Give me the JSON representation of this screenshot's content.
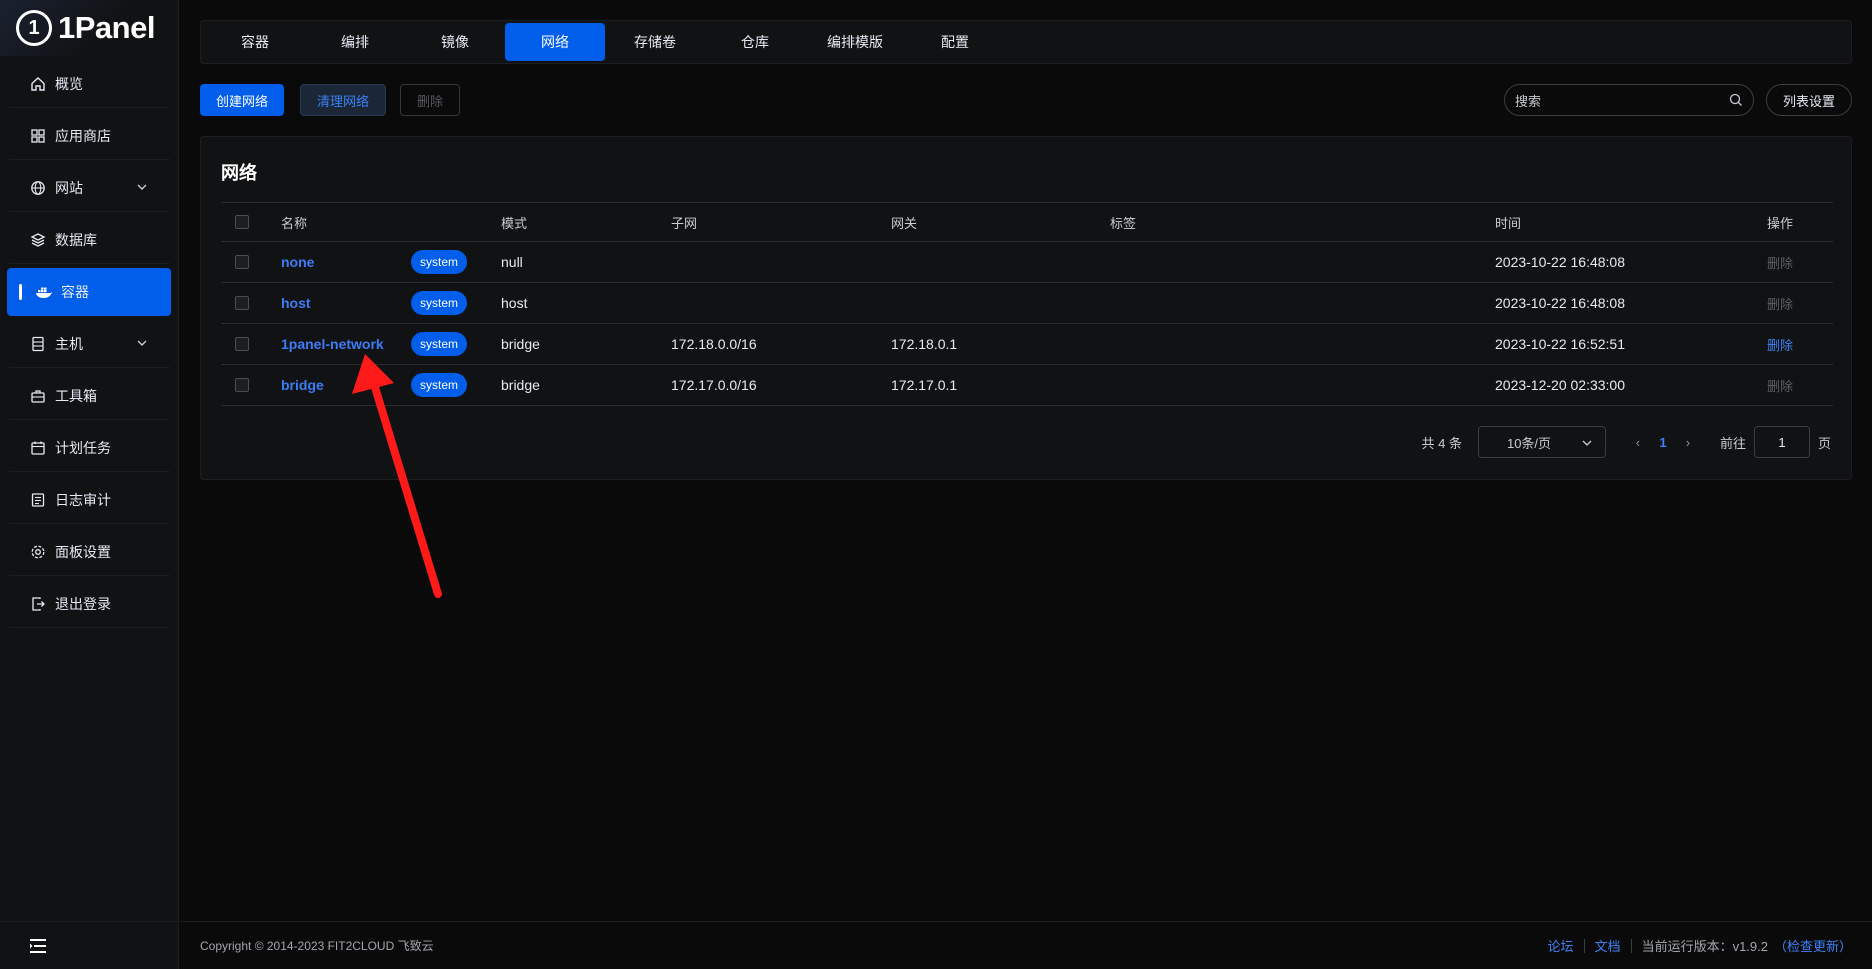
{
  "brand": {
    "logo_glyph": "1",
    "name": "1Panel"
  },
  "sidebar": {
    "items": [
      {
        "label": "概览",
        "icon": "home-icon"
      },
      {
        "label": "应用商店",
        "icon": "grid-icon"
      },
      {
        "label": "网站",
        "icon": "globe-icon",
        "expandable": true
      },
      {
        "label": "数据库",
        "icon": "layers-icon"
      },
      {
        "label": "容器",
        "icon": "docker-icon",
        "active": true
      },
      {
        "label": "主机",
        "icon": "server-icon",
        "expandable": true
      },
      {
        "label": "工具箱",
        "icon": "toolbox-icon"
      },
      {
        "label": "计划任务",
        "icon": "calendar-icon"
      },
      {
        "label": "日志审计",
        "icon": "log-icon"
      },
      {
        "label": "面板设置",
        "icon": "gear-icon"
      },
      {
        "label": "退出登录",
        "icon": "logout-icon"
      }
    ],
    "collapse_icon": "menu-fold-icon"
  },
  "tabs": [
    "容器",
    "编排",
    "镜像",
    "网络",
    "存储卷",
    "仓库",
    "编排模版",
    "配置"
  ],
  "active_tab": "网络",
  "toolbar": {
    "create": "创建网络",
    "prune": "清理网络",
    "delete": "删除",
    "search_placeholder": "搜索",
    "columns": "列表设置"
  },
  "card": {
    "title": "网络"
  },
  "table": {
    "headers": {
      "name": "名称",
      "mode": "模式",
      "subnet": "子网",
      "gateway": "网关",
      "tags": "标签",
      "time": "时间",
      "ops": "操作"
    },
    "rows": [
      {
        "name": "none",
        "tag": "system",
        "mode": "null",
        "subnet": "",
        "gateway": "",
        "time": "2023-10-22 16:48:08",
        "op": "删除",
        "op_enabled": false
      },
      {
        "name": "host",
        "tag": "system",
        "mode": "host",
        "subnet": "",
        "gateway": "",
        "time": "2023-10-22 16:48:08",
        "op": "删除",
        "op_enabled": false
      },
      {
        "name": "1panel-network",
        "tag": "system",
        "mode": "bridge",
        "subnet": "172.18.0.0/16",
        "gateway": "172.18.0.1",
        "time": "2023-10-22 16:52:51",
        "op": "删除",
        "op_enabled": true
      },
      {
        "name": "bridge",
        "tag": "system",
        "mode": "bridge",
        "subnet": "172.17.0.0/16",
        "gateway": "172.17.0.1",
        "time": "2023-12-20 02:33:00",
        "op": "删除",
        "op_enabled": false
      }
    ]
  },
  "pagination": {
    "total": "共 4 条",
    "page_size": "10条/页",
    "prev": "‹",
    "current": "1",
    "next": "›",
    "goto_label": "前往",
    "goto_value": "1",
    "page_unit": "页"
  },
  "footer": {
    "copyright": "Copyright © 2014-2023 FIT2CLOUD 飞致云",
    "forum": "论坛",
    "docs": "文档",
    "version": "当前运行版本：v1.9.2",
    "check_update": "（检查更新）"
  },
  "colors": {
    "accent": "#005eeb",
    "annotation_arrow": "#ff1a1a"
  }
}
